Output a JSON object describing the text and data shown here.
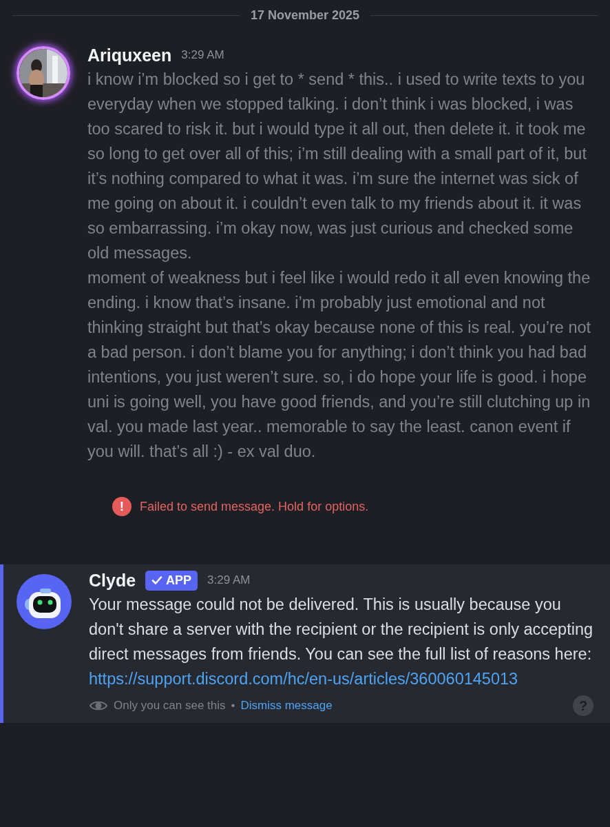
{
  "date_divider": "17 November 2025",
  "message": {
    "author": "Ariquxeen",
    "time": "3:29 AM",
    "paragraphs": [
      "i know i’m blocked so i get to * send * this.. i used to write texts to you everyday when we stopped talking. i don’t think i was blocked, i was too scared to risk it. but i would type it all out, then delete it. it took me so long to get over all of this; i’m still dealing with a small part of it, but it’s nothing compared to what it was. i’m sure the internet was sick of me going on about it. i couldn’t even talk to my friends about it. it was so embarrassing. i’m okay now, was just curious and checked some old messages.",
      "moment of weakness but i feel like i would redo it all even knowing the ending. i know that’s insane. i’m probably just emotional and not thinking straight but that’s okay because none of this is real. you’re not a bad person. i don’t blame you for anything; i don’t think you had bad intentions, you just weren’t sure. so, i do hope your life is good. i hope uni is going well, you have good friends, and you’re still clutching up in val. you made last year.. memorable to say the least. canon event if you will. that’s all :) - ex val duo."
    ],
    "error": {
      "icon": "!",
      "text": "Failed to send message. Hold for options."
    }
  },
  "system_message": {
    "author": "Clyde",
    "badge": "APP",
    "time": "3:29 AM",
    "text": "Your message could not be delivered. This is usually because you don't share a server with the recipient or the recipient is only accepting direct messages from friends. You can see the full list of reasons here:",
    "link": "https://support.discord.com/hc/en-us/articles/360060145013",
    "note": "Only you can see this",
    "separator": "•",
    "dismiss": "Dismiss message",
    "help": "?"
  }
}
